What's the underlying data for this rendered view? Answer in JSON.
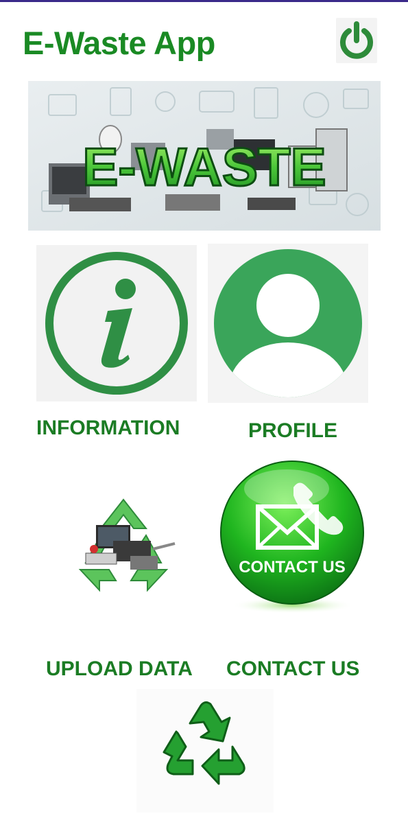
{
  "header": {
    "title": "E-Waste App",
    "power_icon": "power-icon"
  },
  "banner": {
    "text": "E-WASTE"
  },
  "tiles": {
    "information": {
      "label": "INFORMATION",
      "icon": "info-icon"
    },
    "profile": {
      "label": "PROFILE",
      "icon": "user-avatar-icon"
    },
    "upload": {
      "label": "UPLOAD DATA",
      "icon": "recycle-ewaste-icon"
    },
    "contact": {
      "label": "CONTACT US",
      "button_text": "CONTACT US",
      "icon": "envelope-phone-icon"
    }
  },
  "footer": {
    "icon": "recycle-icon"
  },
  "colors": {
    "primary_green": "#1a8a24",
    "tile_green": "#2f9e4f",
    "topbar": "#3b2a8a"
  }
}
